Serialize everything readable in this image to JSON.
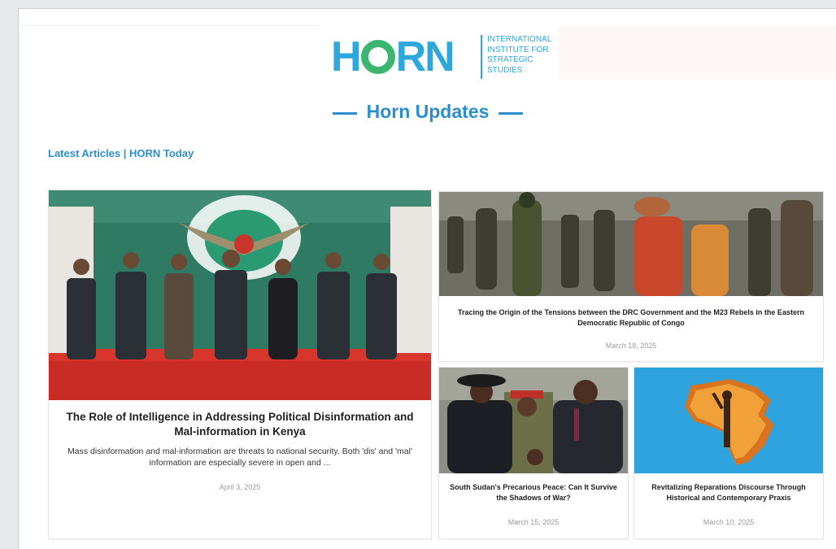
{
  "logo": {
    "wordmark": "HORN",
    "tagline": [
      "INTERNATIONAL",
      "INSTITUTE FOR",
      "STRATEGIC",
      "STUDIES"
    ],
    "brand_color": "#2da7dc",
    "accent_color": "#3bb56f"
  },
  "section": {
    "title": "Horn Updates",
    "subtitle": "Latest Articles | HORN Today"
  },
  "articles": [
    {
      "title": "The Role of Intelligence in Addressing Political Disinformation and Mal-information in Kenya",
      "excerpt": "Mass disinformation and mal-information are threats to national security. Both 'dis' and 'mal' information are especially severe in open and ...",
      "date": "April 3, 2025",
      "image": "officials-group-photo"
    },
    {
      "title": "Tracing the Origin of the Tensions between the DRC Government and the M23 Rebels in the Eastern Democratic Republic of Congo",
      "date": "March 18, 2025",
      "image": "refugees-crowd-photo"
    },
    {
      "title": "South Sudan's Precarious Peace: Can It Survive the Shadows of War?",
      "date": "March 15, 2025",
      "image": "leaders-handshake-photo"
    },
    {
      "title": "Revitalizing Reparations Discourse Through Historical and Contemporary Praxis",
      "date": "March 10, 2025",
      "image": "africa-map-illustration"
    }
  ]
}
